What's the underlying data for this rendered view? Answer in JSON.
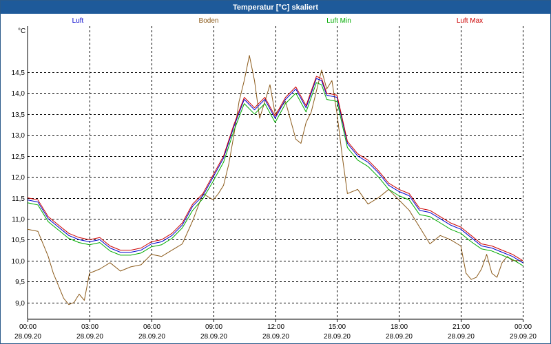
{
  "window": {
    "title": "Temperatur [°C] skaliert"
  },
  "colors": {
    "titlebar": "#1e5a9a",
    "grid": "#000000"
  },
  "chart_data": {
    "type": "line",
    "title": "Temperatur [°C] skaliert",
    "ylabel": "°C",
    "xlabel": "",
    "ylim": [
      8.6,
      15.6
    ],
    "yticks": [
      9.0,
      9.5,
      10.0,
      10.5,
      11.0,
      11.5,
      12.0,
      12.5,
      13.0,
      13.5,
      14.0,
      14.5
    ],
    "ytick_labels": [
      "9,0",
      "9,5",
      "10,0",
      "10,5",
      "11,0",
      "11,5",
      "12,0",
      "12,5",
      "13,0",
      "13,5",
      "14,0",
      "14,5"
    ],
    "xlim": [
      0,
      24
    ],
    "xticks": [
      {
        "h": 0,
        "time": "00:00",
        "date": "28.09.20"
      },
      {
        "h": 3,
        "time": "03:00",
        "date": "28.09.20"
      },
      {
        "h": 6,
        "time": "06:00",
        "date": "28.09.20"
      },
      {
        "h": 9,
        "time": "09:00",
        "date": "28.09.20"
      },
      {
        "h": 12,
        "time": "12:00",
        "date": "28.09.20"
      },
      {
        "h": 15,
        "time": "15:00",
        "date": "28.09.20"
      },
      {
        "h": 18,
        "time": "18:00",
        "date": "28.09.20"
      },
      {
        "h": 21,
        "time": "21:00",
        "date": "28.09.20"
      },
      {
        "h": 24,
        "time": "00:00",
        "date": "29.09.20"
      }
    ],
    "grid": true,
    "legend_placement": "top",
    "series": [
      {
        "name": "Luft",
        "color": "#0000cc",
        "x": [
          0,
          0.5,
          1,
          1.5,
          2,
          2.5,
          3,
          3.5,
          4,
          4.5,
          5,
          5.5,
          6,
          6.5,
          7,
          7.5,
          8,
          8.5,
          9,
          9.5,
          10,
          10.5,
          11,
          11.5,
          12,
          12.5,
          13,
          13.5,
          14,
          14.25,
          14.5,
          15,
          15.5,
          16,
          16.5,
          17,
          17.5,
          18,
          18.5,
          19,
          19.5,
          20,
          20.5,
          21,
          21.5,
          22,
          22.5,
          23,
          23.5,
          24
        ],
        "y": [
          11.45,
          11.4,
          11.0,
          10.8,
          10.6,
          10.5,
          10.45,
          10.5,
          10.3,
          10.2,
          10.2,
          10.25,
          10.4,
          10.45,
          10.6,
          10.85,
          11.3,
          11.55,
          12.0,
          12.45,
          13.2,
          13.85,
          13.6,
          13.85,
          13.4,
          13.85,
          14.1,
          13.65,
          14.35,
          14.3,
          13.95,
          13.9,
          12.8,
          12.5,
          12.35,
          12.1,
          11.8,
          11.65,
          11.55,
          11.2,
          11.15,
          11.0,
          10.85,
          10.75,
          10.55,
          10.35,
          10.3,
          10.2,
          10.1,
          9.95
        ]
      },
      {
        "name": "Boden",
        "color": "#8b5a1a",
        "x": [
          0,
          0.5,
          1,
          1.25,
          1.5,
          1.75,
          2,
          2.25,
          2.5,
          2.75,
          3,
          3.5,
          4,
          4.5,
          5,
          5.5,
          6,
          6.5,
          7,
          7.5,
          8,
          8.5,
          9,
          9.25,
          9.5,
          9.75,
          10,
          10.25,
          10.5,
          10.75,
          11,
          11.25,
          11.5,
          11.75,
          12,
          12.5,
          13,
          13.25,
          13.5,
          13.75,
          14,
          14.25,
          14.5,
          14.75,
          15,
          15.25,
          15.5,
          16,
          16.5,
          17,
          17.5,
          18,
          18.5,
          19,
          19.5,
          20,
          20.5,
          21,
          21.25,
          21.5,
          21.75,
          22,
          22.25,
          22.5,
          22.75,
          23,
          23.25,
          23.5,
          24
        ],
        "y": [
          10.75,
          10.7,
          10.1,
          9.7,
          9.4,
          9.1,
          8.95,
          9.0,
          9.2,
          9.05,
          9.7,
          9.8,
          9.95,
          9.75,
          9.85,
          9.9,
          10.15,
          10.1,
          10.25,
          10.4,
          10.95,
          11.6,
          11.45,
          11.6,
          11.8,
          12.3,
          13.0,
          13.8,
          14.3,
          14.9,
          14.3,
          13.4,
          13.8,
          14.2,
          13.5,
          13.8,
          12.9,
          12.8,
          13.3,
          13.55,
          14.05,
          14.55,
          14.1,
          14.3,
          13.5,
          12.5,
          11.6,
          11.7,
          11.35,
          11.5,
          11.7,
          11.45,
          11.2,
          10.8,
          10.4,
          10.6,
          10.5,
          10.35,
          9.7,
          9.55,
          9.6,
          9.8,
          10.15,
          9.7,
          9.6,
          9.95,
          10.1,
          10.0,
          10.0
        ]
      },
      {
        "name": "Luft Min",
        "color": "#00aa00",
        "x": [
          0,
          0.5,
          1,
          1.5,
          2,
          2.5,
          3,
          3.5,
          4,
          4.5,
          5,
          5.5,
          6,
          6.5,
          7,
          7.5,
          8,
          8.5,
          9,
          9.5,
          10,
          10.5,
          11,
          11.5,
          12,
          12.5,
          13,
          13.5,
          14,
          14.25,
          14.5,
          15,
          15.5,
          16,
          16.5,
          17,
          17.5,
          18,
          18.5,
          19,
          19.5,
          20,
          20.5,
          21,
          21.5,
          22,
          22.5,
          23,
          23.5,
          24
        ],
        "y": [
          11.38,
          11.33,
          10.93,
          10.73,
          10.53,
          10.43,
          10.38,
          10.43,
          10.23,
          10.13,
          10.13,
          10.18,
          10.33,
          10.38,
          10.53,
          10.78,
          11.2,
          11.48,
          11.9,
          12.35,
          13.1,
          13.75,
          13.5,
          13.75,
          13.3,
          13.75,
          14.0,
          13.55,
          14.25,
          14.2,
          13.85,
          13.8,
          12.7,
          12.4,
          12.25,
          12.0,
          11.7,
          11.55,
          11.45,
          11.1,
          11.05,
          10.9,
          10.75,
          10.65,
          10.45,
          10.28,
          10.23,
          10.13,
          10.03,
          9.88
        ]
      },
      {
        "name": "Luft Max",
        "color": "#cc0000",
        "x": [
          0,
          0.5,
          1,
          1.5,
          2,
          2.5,
          3,
          3.5,
          4,
          4.5,
          5,
          5.5,
          6,
          6.5,
          7,
          7.5,
          8,
          8.5,
          9,
          9.5,
          10,
          10.5,
          11,
          11.5,
          12,
          12.5,
          13,
          13.5,
          14,
          14.25,
          14.5,
          15,
          15.5,
          16,
          16.5,
          17,
          17.5,
          18,
          18.5,
          19,
          19.5,
          20,
          20.5,
          21,
          21.5,
          22,
          22.5,
          23,
          23.5,
          24
        ],
        "y": [
          11.5,
          11.45,
          11.05,
          10.85,
          10.65,
          10.55,
          10.5,
          10.55,
          10.35,
          10.25,
          10.25,
          10.3,
          10.45,
          10.5,
          10.65,
          10.9,
          11.35,
          11.6,
          12.05,
          12.5,
          13.25,
          13.9,
          13.65,
          13.9,
          13.45,
          13.9,
          14.15,
          13.7,
          14.4,
          14.35,
          14.0,
          13.95,
          12.85,
          12.55,
          12.4,
          12.15,
          11.85,
          11.7,
          11.6,
          11.25,
          11.2,
          11.05,
          10.9,
          10.8,
          10.6,
          10.4,
          10.35,
          10.25,
          10.15,
          10.0
        ]
      }
    ]
  }
}
